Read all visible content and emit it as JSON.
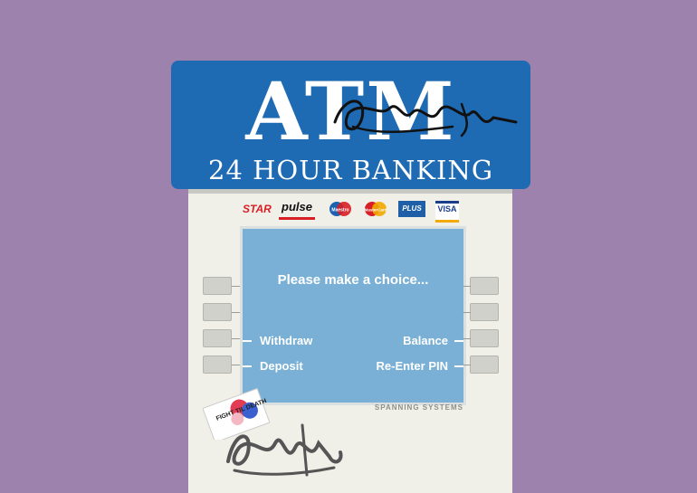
{
  "sign": {
    "title": "ATM",
    "subtitle": "24 HOUR BANKING",
    "bg_color": "#1e6ab3"
  },
  "network_logos": {
    "star": "STAR",
    "pulse": "pulse",
    "maestro": "Maestro",
    "mastercard": "MasterCard",
    "plus": "PLUS",
    "visa": "VISA"
  },
  "screen": {
    "prompt": "Please make a choice...",
    "left_options": [
      "Withdraw",
      "Deposit"
    ],
    "right_options": [
      "Balance",
      "Re-Enter PIN"
    ],
    "bg_color": "#7ab0d5"
  },
  "brand": "SPANNING SYSTEMS",
  "sticker_text": "FIGHT TIL DEATH",
  "colors": {
    "page_bg": "#9e82ae",
    "machine_body": "#f0efe8",
    "key": "#d1d1cc"
  }
}
